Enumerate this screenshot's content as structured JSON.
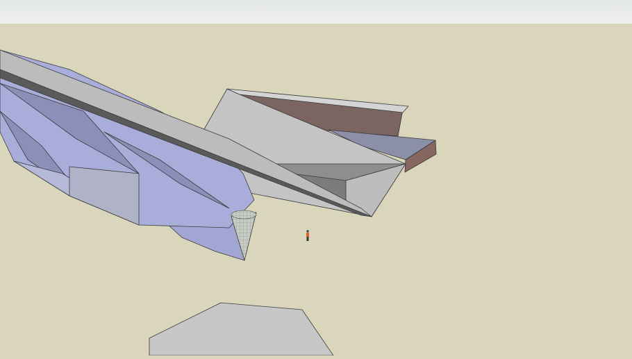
{
  "scene": {
    "sky_color_top": "#e2e6e4",
    "sky_color_bottom": "#eef0ee",
    "ground_color": "#d9d6bb",
    "colors": {
      "wing": "#a9add9",
      "wing_shadow": "#8c90b8",
      "concrete": "#c4c4c4",
      "concrete_dark": "#8e8e8e",
      "brick": "#7a6560",
      "roof": "#8b8fa8",
      "cone": "#c6ccc3",
      "person_vest": "#e0602a"
    }
  }
}
